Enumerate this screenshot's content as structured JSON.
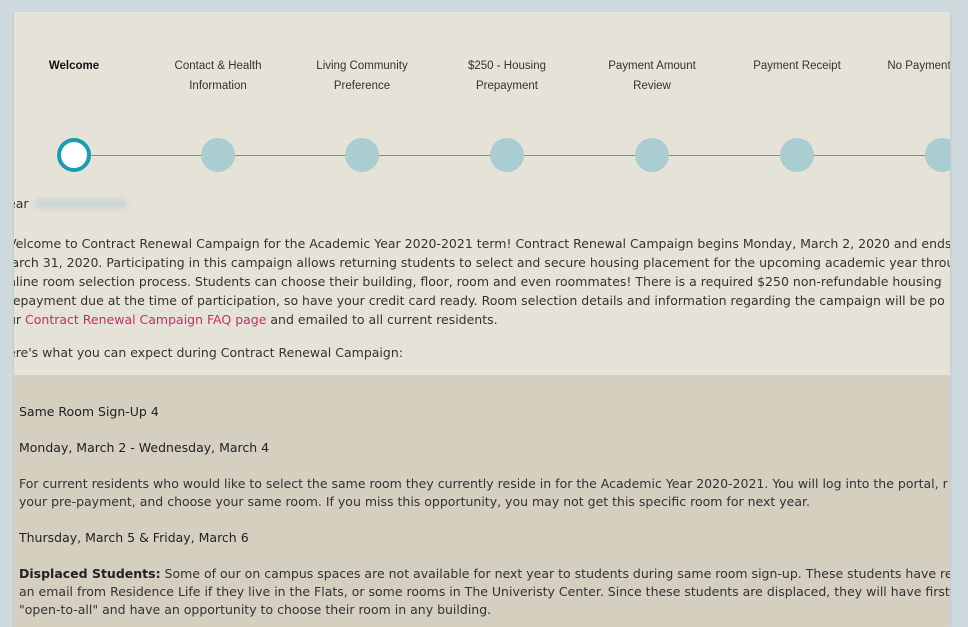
{
  "steps": [
    {
      "label": "Welcome",
      "current": true
    },
    {
      "label": "Contact & Health Information",
      "current": false
    },
    {
      "label": "Living Community Preference",
      "current": false
    },
    {
      "label": "$250 - Housing Prepayment",
      "current": false
    },
    {
      "label": "Payment Amount Review",
      "current": false
    },
    {
      "label": "Payment Receipt",
      "current": false
    },
    {
      "label": "No Payment",
      "current": false
    }
  ],
  "greeting": {
    "prefix": "ear"
  },
  "welcome": {
    "line1": "Velcome to Contract Renewal Campaign for the Academic Year 2020-2021 term! Contract Renewal Campaign begins Monday, March 2, 2020 and ends",
    "line2": "larch 31, 2020. Participating in this campaign allows returning students to select and secure housing placement for the upcoming academic year throu",
    "line3": "nline room selection process. Students can choose their building, floor, room and even roommates! There is a required $250 non-refundable housing",
    "line4": "repayment due at the time of participation, so have your credit card ready. Room selection details and information regarding the campaign will be po",
    "line5_before": "ur ",
    "faq_link": "Contract Renewal Campaign FAQ page",
    "line5_after": " and emailed to all current residents."
  },
  "expect_text": "ere's what you can expect during Contract Renewal Campaign:",
  "panel": {
    "heading": "Same Room Sign-Up 4",
    "date1": "Monday, March 2 - Wednesday, March 4",
    "desc1_line1": "For current residents who would like to select the same room they currently reside in for the Academic Year 2020-2021. You will log into the portal, r",
    "desc1_line2": "your pre-payment, and choose your same room. If you miss this opportunity, you may not get this specific room for next year.",
    "date2": "Thursday, March 5 & Friday, March 6",
    "displaced_label": "Displaced Students:",
    "displaced_line1": " Some of our on campus spaces are not available for next year to students during same room sign-up. These students have rece",
    "displaced_line2": "an email from Residence Life if they live in the Flats, or some rooms in The Univeristy Center. Since these students are displaced, they will have first c",
    "displaced_line3": "\"open-to-all\" and have an opportunity to choose their room in any building."
  },
  "colors": {
    "page_bg": "#e5e3d8",
    "panel_bg": "#d5cfc0",
    "frame": "#cdd9dd",
    "step_dot": "#a9cdd0",
    "current_ring": "#1a9cb3",
    "link": "#c0306a"
  }
}
